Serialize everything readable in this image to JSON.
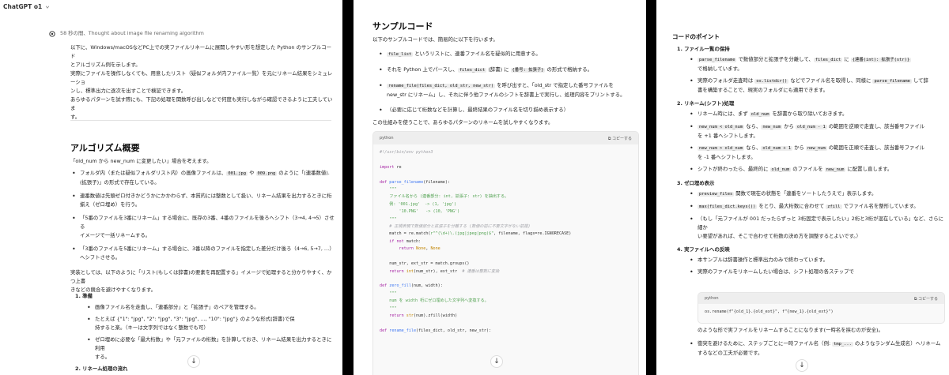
{
  "panel1": {
    "model_label": "ChatGPT o1",
    "chevron": "chevron-down-icon",
    "thought_header": "58 秒の間、Thought about image file renaming algorithm",
    "intro_lines": [
      "以下に、Windows/macOSなどPC上での実ファイルリネームに展開しやすい形を想定した Python のサンプルコード",
      "とアルゴリズム例を示します。",
      "実際にファイルを操作しなくても、用意したリスト（疑似フォルダ内ファイル一覧）を元にリネーム結果をシミュレーショ",
      "ンし、標準出力に逐次を出すことで検証できます。",
      "あらゆるパターンを試す際にも、下記の処理を関数呼び出しなどで何度も実行しながら確認できるように工夫していま",
      "す。"
    ],
    "section_title": "アルゴリズム概要",
    "overview_line": "「old_num から new_num に変更したい」場合を考えます。",
    "bullets": [
      [
        "フォルダ内（または疑似フォルダリスト内）の画像ファイルは、",
        "001.jpg",
        " や ",
        "009.png",
        " のように「(連番数値).",
        "(拡張子)」の形式で存在している。"
      ],
      [
        "連番数値は先頭ゼロ付きかどうかにかかわらず、本質的には整数として扱い、リネーム結果を出力するときに桁",
        "揃え（ゼロ埋め）を行う。"
      ],
      [
        "「5番のファイルを3番にリネーム」する場合に、既存の3番、4番のファイルを後ろへシフト（3→4, 4→5）させる",
        "イメージで一括リネームする。"
      ],
      [
        "「3番のファイルを5番にリネーム」する場合に、3番以降のファイルを指定した差分だけ後ろ（4→6, 5→7, …）",
        "へシフトさせる。"
      ]
    ],
    "summary_lines": [
      "実装としては、以下のように「リスト(もしくは辞書)の要素を再配置する」イメージで処理すると分かりやすく、かつ上書",
      "きなどの競合を避けやすくなります。"
    ],
    "step1": "1. 準備",
    "step1_bullets": [
      "画像ファイル名を走査し、「連番部分」と「拡張子」のペアを管理する。",
      "たとえば {\"1\": \"jpg\", \"2\": \"jpg\", \"3\": \"jpg\", ..., \"10\": \"jpg\"} のような形式(辞書)で保",
      "持すると楽。（キーは文字列ではなく整数でも可）",
      "ゼロ埋めに必要な「最大桁数」や「元ファイルの桁数」を計算しておき、リネーム結果を出力するときに利用",
      "する。"
    ],
    "step2": "2. リネーム処理の流れ",
    "scroll_icon": "arrow-down-icon"
  },
  "panel2": {
    "title": "サンプルコード",
    "intro": "以下のサンプルコードでは、簡易的に以下を行います。",
    "bullets": [
      [
        "file_list",
        " というリストに、連番ファイル名を疑似的に用意する。"
      ],
      [
        "それを Python 上でパースし、",
        "files_dict",
        " (辞書) に ",
        "{番号: 拡張子}",
        " の形式で格納する。"
      ],
      [
        "rename_file(files_dict, old_str, new_str)",
        " を呼び出すと、「old_str で指定した番号ファイルを"
      ],
      [
        "（必要に応じて桁数などを計算し、最終結果のファイル名を切り揃め表示する）"
      ]
    ],
    "rename_cont": "new_str にリネーム」し、それに伴う他ファイルのシフトを辞書上で実行し、処理内容をプリントする。",
    "usage_line": "この仕組みを使うことで、あらゆるパターンのリネームを試しやすくなります。",
    "code_lang": "python",
    "copy_label": "コピーする",
    "copy_icon": "copy-icon",
    "scroll_icon": "arrow-down-icon"
  },
  "panel3": {
    "title": "コードのポイント",
    "items": [
      {
        "heading": "1. ファイル一覧の保持",
        "bullets": [
          [
            "parse_filename",
            " で数値部分と拡張子を分離して、",
            "files_dict",
            " に ",
            "{連番(int): 拡張子(str)}",
            ""
          ],
          [
            "で格納しています。"
          ],
          [
            "実際のフォルダ走査時は ",
            "os.listdir()",
            " などでファイル名を取得し、同様に ",
            "parse_filename",
            " して辞"
          ],
          [
            "書を構築することで、現実のフォルダにも適用できます。"
          ]
        ]
      },
      {
        "heading": "2. リネーム(シフト)処理",
        "bullets": [
          [
            "リネーム時には、まず ",
            "old_num",
            " を辞書から取り除いておきます。"
          ],
          [
            "new_num < old_num",
            " なら、",
            "new_num",
            " から ",
            "old_num - 1",
            " の範囲を逆順で走査し、該当番号ファイル"
          ],
          [
            "を +1 番へシフトします。"
          ],
          [
            "new_num > old_num",
            " なら、",
            "old_num + 1",
            " から ",
            "new_num",
            " の範囲を正順で走査し、該当番号ファイル"
          ],
          [
            "を -1 番へシフトします。"
          ],
          [
            "シフトが終わったら、最終的に ",
            "old_num",
            " のファイルを ",
            "new_num",
            " に配置し直します。"
          ]
        ]
      },
      {
        "heading": "3. ゼロ埋め表示",
        "bullets": [
          [
            "preview_files",
            " 関数で現在の状態を「連番をソートしたうえで」表示します。"
          ],
          [
            "max(files_dict.keys())",
            " をとり、最大桁数に合わせて ",
            "zfill",
            " でファイル名を整形しています。"
          ],
          [
            "（もし「元ファイルが 001 だったらずっと 3桁固定で表示したい」2桁と3桁が混在している」など、さらに細か"
          ],
          [
            "い要望があれば、そこで合わせて桁数の決め方を調整するとよいです。）"
          ]
        ]
      },
      {
        "heading": "4. 実ファイルへの反映",
        "bullets": [
          [
            "本サンプルは辞書操作と標準出力のみで終わっています。"
          ],
          [
            "実際のファイルをリネームしたい場合は、シフト処理の各ステップで"
          ]
        ]
      }
    ],
    "code_lang": "python",
    "copy_label": "コピーする",
    "code_line": "os.rename(f\"{old_1}.{old_ext}\", f\"{new_1}.{old_ext}\")",
    "after_code": "のような形で実ファイルをリネームすることになります(一時名を挟むのが安全)。",
    "last_bullet_1": "衝突を避けるために、ステップごとに一時ファイル名（例: ",
    "last_code": "tmp_...",
    "last_bullet_2": " のようなランダム生成名）へリネーム",
    "last_cont": "するなどの工夫が必要です。",
    "scroll_icon": "arrow-down-icon"
  }
}
